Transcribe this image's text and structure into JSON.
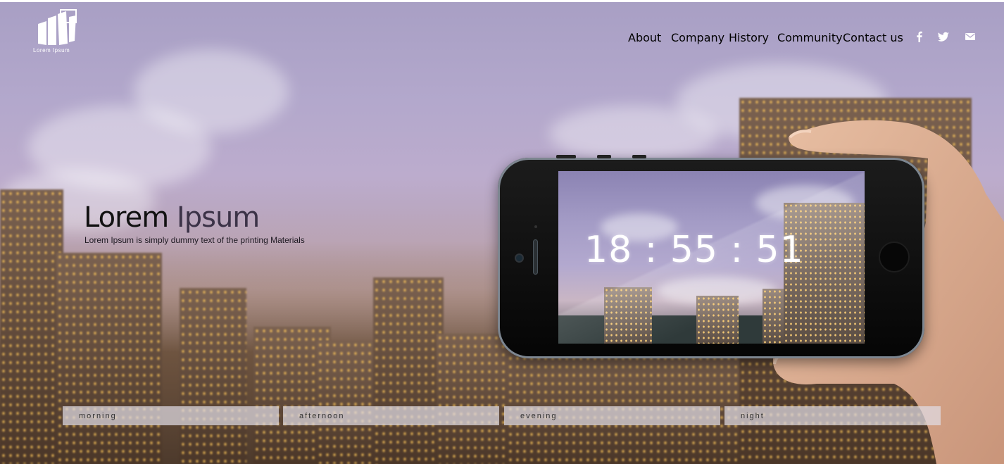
{
  "brand": {
    "logo_text": "Lorem Ipsum"
  },
  "nav": {
    "items": [
      "About",
      "Company",
      "History",
      "Community",
      "Contact us"
    ]
  },
  "social": {
    "icons": [
      "facebook-icon",
      "twitter-icon",
      "mail-icon"
    ]
  },
  "hero": {
    "title_bold": "Lorem",
    "title_light": "Ipsum",
    "subtitle": "Lorem Ipsum is simply dummy text of the printing Materials"
  },
  "phone": {
    "clock": "18 : 55 : 51"
  },
  "tabs": [
    "morning",
    "afternoon",
    "evening",
    "night"
  ],
  "colors": {
    "sky": "#b3a8cc",
    "tab_bg": "#e1dce4",
    "text_dark": "#111111"
  }
}
